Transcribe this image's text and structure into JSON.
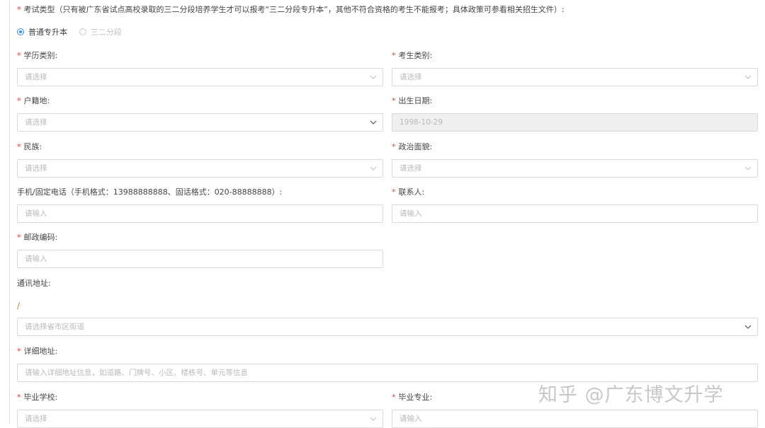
{
  "exam_type": {
    "label": "考试类型（只有被广东省试点高校录取的三二分段培养学生才可以报考“三二分段专升本”，其他不符合资格的考生不能报考；具体政策可参看相关招生文件）:",
    "options": [
      {
        "label": "普通专升本",
        "selected": true
      },
      {
        "label": "三二分段",
        "selected": false
      }
    ]
  },
  "fields": {
    "education_category": {
      "label": "学历类别:",
      "placeholder": "请选择"
    },
    "candidate_category": {
      "label": "考生类别:",
      "placeholder": "请选择"
    },
    "household_registration": {
      "label": "户籍地:",
      "placeholder": "请选择"
    },
    "birth_date": {
      "label": "出生日期:",
      "value": "1998-10-29"
    },
    "ethnicity": {
      "label": "民族:",
      "placeholder": "请选择"
    },
    "political_status": {
      "label": "政治面貌:",
      "placeholder": "请选择"
    },
    "phone": {
      "label": "手机/固定电话（手机格式：13988888888、固话格式：020-88888888）:",
      "placeholder": "请输入"
    },
    "contact": {
      "label": "联系人:",
      "placeholder": "请输入"
    },
    "postal_code": {
      "label": "邮政编码:",
      "placeholder": "请输入"
    },
    "mailing_address": {
      "label": "通讯地址:",
      "separator": "/",
      "placeholder": "请选择省市区街道"
    },
    "detailed_address": {
      "label": "详细地址:",
      "placeholder": "请输入详细地址信息，如道路、门牌号、小区、楼栋号、单元等信息"
    },
    "graduate_school": {
      "label": "毕业学校:",
      "placeholder": "请选择"
    },
    "graduate_major": {
      "label": "毕业专业:",
      "placeholder": "请输入"
    }
  },
  "required_mark": "*",
  "watermark": "知乎 @广东博文升学",
  "colors": {
    "required": "#e0403d",
    "accent": "#2d8cf0",
    "border": "#d9d9d9",
    "placeholder": "#b9b9b9"
  }
}
